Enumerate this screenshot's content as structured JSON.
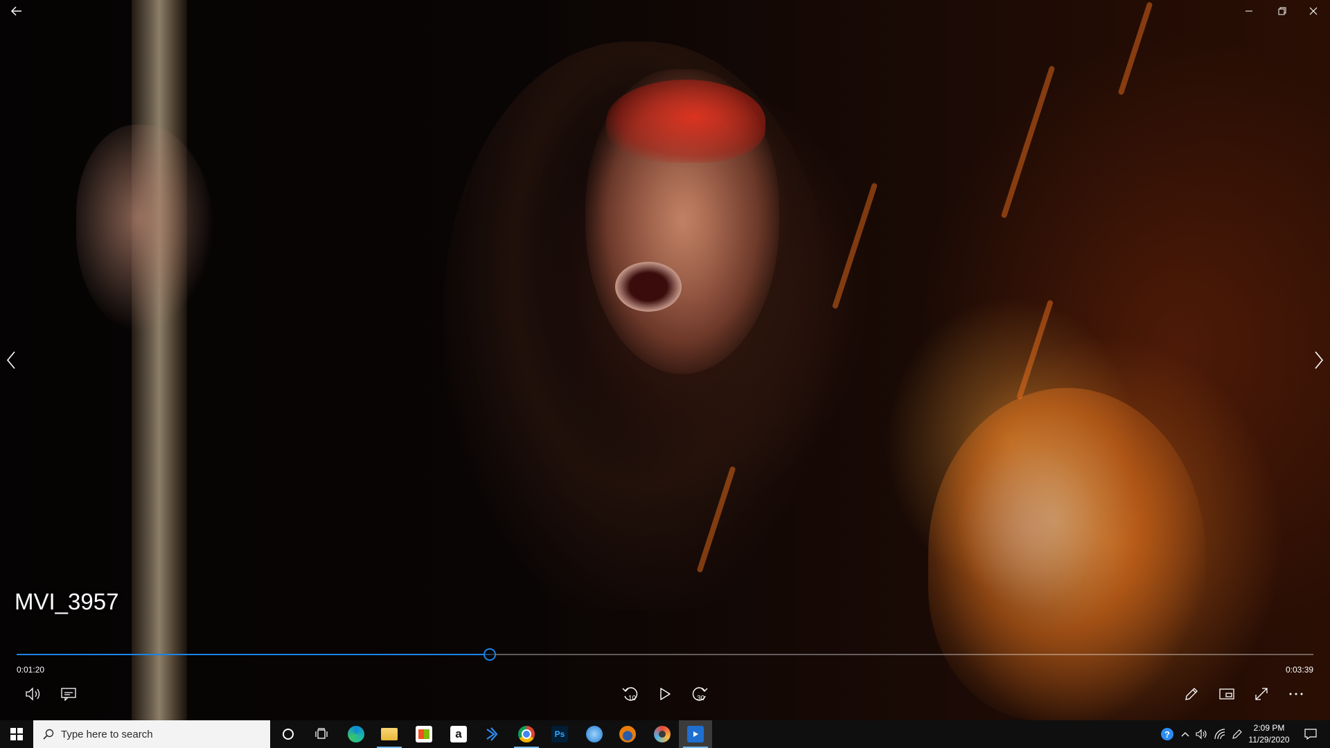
{
  "video": {
    "title": "MVI_3957",
    "elapsed": "0:01:20",
    "duration": "0:03:39",
    "progress_fraction": 0.365
  },
  "colors": {
    "accent": "#1d84e6",
    "taskbar": "#0f0f0f",
    "search_box": "#f3f3f3"
  },
  "window_controls": {
    "back_icon": "back-arrow-icon",
    "minimize_icon": "minimize-icon",
    "maximize_icon": "restore-icon",
    "close_icon": "close-icon"
  },
  "navigation": {
    "prev_icon": "chevron-left-icon",
    "next_icon": "chevron-right-icon"
  },
  "player_controls": {
    "left": [
      "volume-icon",
      "subtitles-icon"
    ],
    "center": [
      "rewind-10-icon",
      "play-icon",
      "forward-30-icon"
    ],
    "rewind_label": "10",
    "forward_label": "30",
    "right": [
      "pen-icon",
      "mini-view-icon",
      "fullscreen-icon",
      "more-icon"
    ]
  },
  "taskbar": {
    "search_placeholder": "Type here to search",
    "pinned": [
      "cortana",
      "task-view",
      "edge",
      "file-explorer",
      "microsoft-store",
      "amazon",
      "visual-studio",
      "chrome",
      "photoshop",
      "thunderbird",
      "blender",
      "davinci-resolve",
      "movies-tv"
    ],
    "amazon_label": "a",
    "photoshop_label": "Ps"
  },
  "system_tray": {
    "icons": [
      "help-icon",
      "show-hidden-icons",
      "speaker-icon",
      "network-icon",
      "pen-workspace-icon",
      "notifications-icon"
    ],
    "time": "2:09 PM",
    "date": "11/29/2020"
  }
}
